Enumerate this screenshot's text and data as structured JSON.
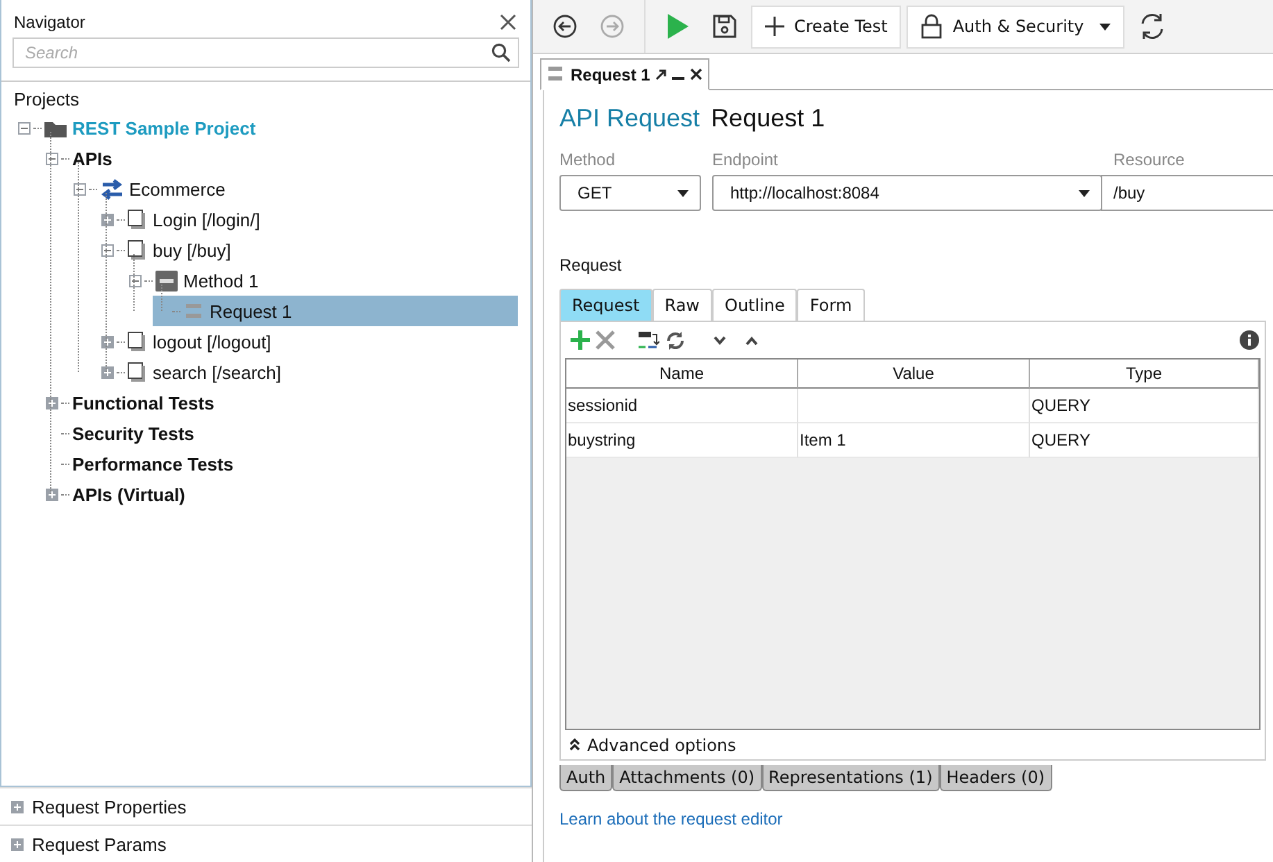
{
  "navigator": {
    "title": "Navigator",
    "search": {
      "placeholder": "Search"
    },
    "section": "Projects",
    "tree": [
      {
        "label": "REST Sample Project",
        "kind": "project",
        "expanded": true,
        "selected": false,
        "children": [
          {
            "label": "APIs",
            "kind": "group",
            "expanded": true,
            "selected": false,
            "children": [
              {
                "label": "Ecommerce",
                "kind": "api",
                "expanded": true,
                "selected": false,
                "children": [
                  {
                    "label": "Login [/login/]",
                    "kind": "resource",
                    "expanded": false,
                    "selected": false
                  },
                  {
                    "label": "buy [/buy]",
                    "kind": "resource",
                    "expanded": true,
                    "selected": false,
                    "children": [
                      {
                        "label": "Method 1",
                        "kind": "method",
                        "expanded": true,
                        "selected": false,
                        "children": [
                          {
                            "label": "Request 1",
                            "kind": "request",
                            "selected": true
                          }
                        ]
                      }
                    ]
                  },
                  {
                    "label": "logout [/logout]",
                    "kind": "resource",
                    "expanded": false,
                    "selected": false
                  },
                  {
                    "label": "search [/search]",
                    "kind": "resource",
                    "expanded": false,
                    "selected": false
                  }
                ]
              }
            ]
          },
          {
            "label": "Functional Tests",
            "kind": "group",
            "expanded": false,
            "selected": false
          },
          {
            "label": "Security Tests",
            "kind": "group",
            "selected": false
          },
          {
            "label": "Performance Tests",
            "kind": "group",
            "selected": false
          },
          {
            "label": "APIs (Virtual)",
            "kind": "group",
            "expanded": false,
            "selected": false
          }
        ]
      }
    ],
    "bottom_sections": [
      {
        "label": "Request Properties",
        "expanded": false
      },
      {
        "label": "Request Params",
        "expanded": false
      }
    ]
  },
  "toolbar": {
    "buttons": [
      {
        "kind": "back",
        "disabled": false
      },
      {
        "kind": "forward",
        "disabled": true
      },
      {
        "kind": "run",
        "disabled": false
      },
      {
        "kind": "save",
        "disabled": false
      },
      {
        "kind": "create",
        "label": "Create Test",
        "disabled": false
      },
      {
        "kind": "dropdown",
        "label": "Auth & Security",
        "disabled": false
      },
      {
        "kind": "refresh",
        "disabled": false
      }
    ]
  },
  "editor_tab": {
    "label": "Request 1"
  },
  "editor": {
    "type_label": "API Request",
    "title": "Request 1",
    "method": {
      "label": "Method",
      "value": "GET"
    },
    "endpoint": {
      "label": "Endpoint",
      "value": "http://localhost:8084"
    },
    "resource": {
      "label": "Resource",
      "value": "/buy"
    },
    "section": "Request",
    "tabs": [
      {
        "label": "Request",
        "selected": true
      },
      {
        "label": "Raw",
        "selected": false
      },
      {
        "label": "Outline",
        "selected": false
      },
      {
        "label": "Form",
        "selected": false
      }
    ],
    "table": {
      "columns": [
        "Name",
        "Value",
        "Type"
      ],
      "rows": [
        {
          "name": "sessionid",
          "type": "QUERY"
        },
        {
          "name": "buystring",
          "value": "Item 1",
          "type": "QUERY"
        }
      ]
    },
    "advanced": "Advanced options",
    "bottom_tabs": [
      {
        "label": "Auth"
      },
      {
        "label": "Attachments (0)"
      },
      {
        "label": "Representations (1)"
      },
      {
        "label": "Headers (0)"
      }
    ],
    "link": "Learn about the request editor"
  }
}
